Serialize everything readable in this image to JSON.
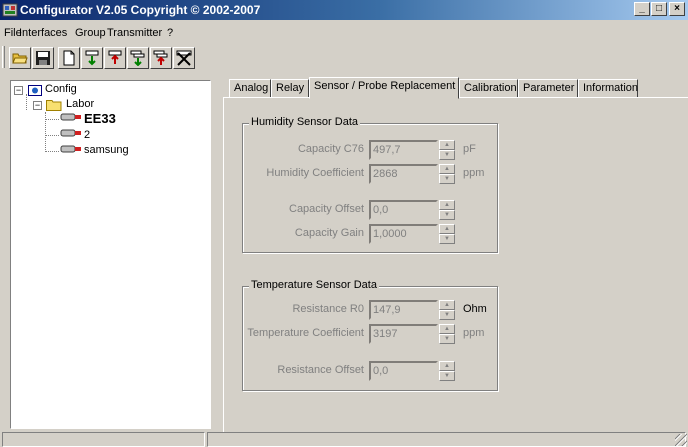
{
  "window": {
    "title": "Configurator  V2.05 Copyright © 2002-2007",
    "controls": {
      "minimize": "_",
      "maximize": "□",
      "close": "×"
    }
  },
  "menu": [
    "File",
    "Interfaces",
    "Group",
    "Transmitter",
    "?"
  ],
  "toolbar": {
    "buttons": [
      "open-folder-icon",
      "save-icon",
      "new-document-icon",
      "download-icon",
      "upload-icon",
      "download-group-icon",
      "upload-group-icon",
      "delete-icon"
    ]
  },
  "tree": {
    "root": "Config",
    "group": "Labor",
    "transmitters": [
      "EE33",
      "2",
      "samsung"
    ]
  },
  "tabs": [
    "Analog",
    "Relay",
    "Sensor / Probe Replacement",
    "Calibration",
    "Parameter",
    "Information"
  ],
  "active_tab": "Sensor / Probe Replacement",
  "humidity": {
    "title": "Humidity Sensor Data",
    "capacity_c76": {
      "label": "Capacity C76",
      "value": "497,7",
      "unit": "pF"
    },
    "humidity_coefficient": {
      "label": "Humidity Coefficient",
      "value": "2868",
      "unit": "ppm"
    },
    "capacity_offset": {
      "label": "Capacity Offset",
      "value": "0,0"
    },
    "capacity_gain": {
      "label": "Capacity Gain",
      "value": "1,0000"
    }
  },
  "temperature": {
    "title": "Temperature Sensor Data",
    "resistance_r0": {
      "label": "Resistance R0",
      "value": "147,9",
      "unit": "Ohm"
    },
    "temperature_coefficient": {
      "label": "Temperature Coefficient",
      "value": "3197",
      "unit": "ppm"
    },
    "resistance_offset": {
      "label": "Resistance Offset",
      "value": "0,0"
    }
  },
  "colors": {
    "title_start": "#0a246a",
    "title_end": "#a6caf0",
    "face": "#d4d0c8"
  }
}
